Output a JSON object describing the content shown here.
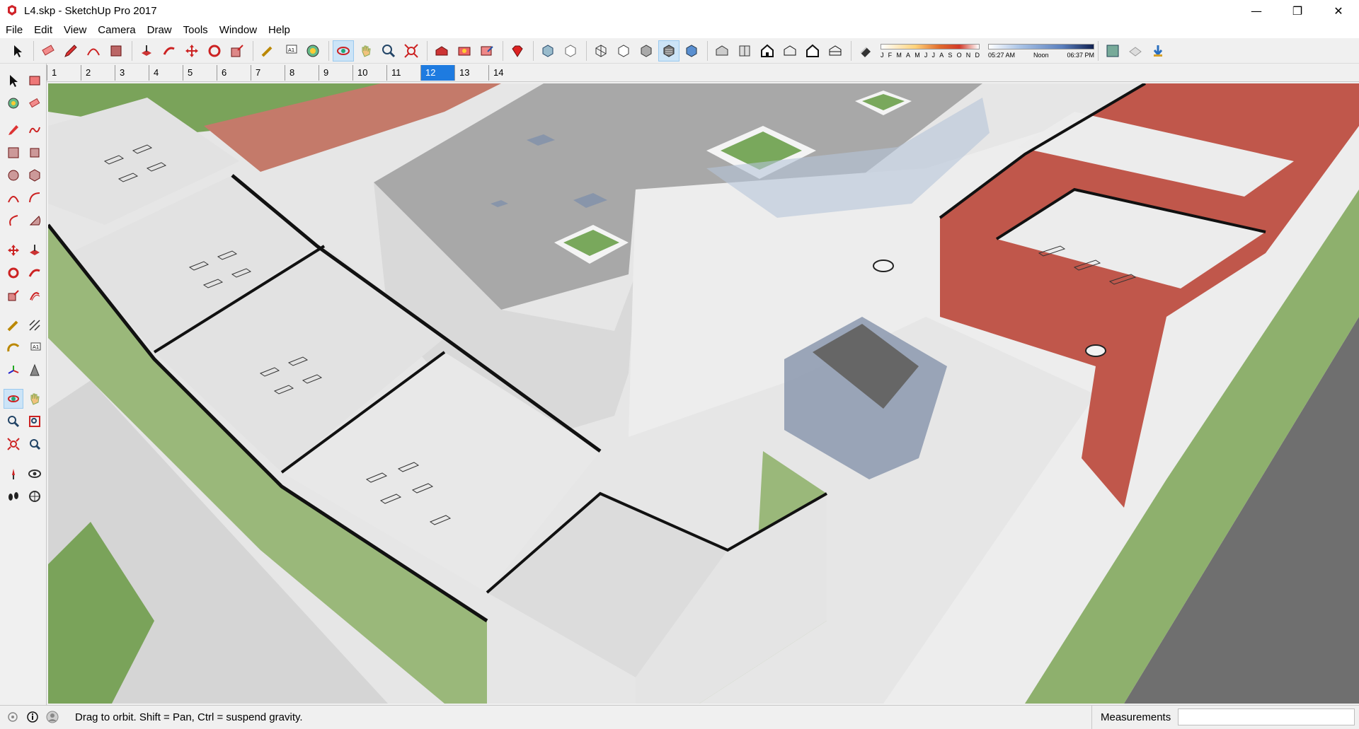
{
  "window": {
    "title": "L4.skp - SketchUp Pro 2017",
    "controls": [
      "—",
      "❐",
      "✕"
    ]
  },
  "menu": [
    "File",
    "Edit",
    "View",
    "Camera",
    "Draw",
    "Tools",
    "Window",
    "Help"
  ],
  "shadows": {
    "months": [
      "J",
      "F",
      "M",
      "A",
      "M",
      "J",
      "J",
      "A",
      "S",
      "O",
      "N",
      "D"
    ],
    "time_start": "05:27 AM",
    "time_mid": "Noon",
    "time_end": "06:37 PM"
  },
  "scenes": {
    "tabs": [
      "1",
      "2",
      "3",
      "4",
      "5",
      "6",
      "7",
      "8",
      "9",
      "10",
      "11",
      "12",
      "13",
      "14"
    ],
    "active": "12"
  },
  "status": {
    "hint": "Drag to orbit. Shift = Pan, Ctrl = suspend gravity.",
    "measurements_label": "Measurements",
    "measurements_value": ""
  },
  "colors": {
    "accent": "#1e7be0",
    "grass": "#7aa35a",
    "brick": "#c0574b",
    "facade_green": "#9ab87a",
    "glass": "#9fb4cf",
    "floor": "#e9e9e9"
  }
}
